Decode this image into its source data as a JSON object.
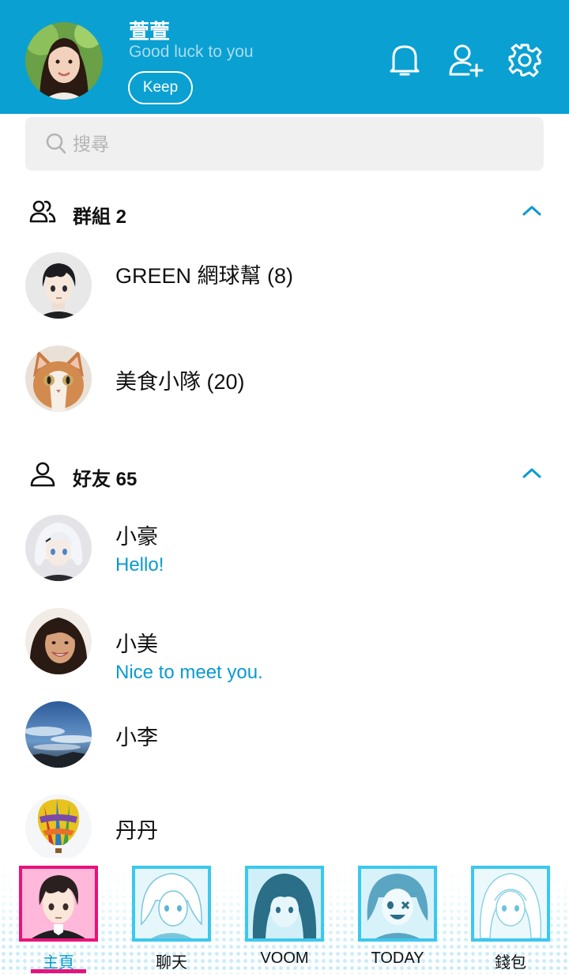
{
  "header": {
    "name": "萱萱",
    "status": "Good luck to you",
    "keep_label": "Keep",
    "icons": [
      "bell-icon",
      "add-friend-icon",
      "gear-icon"
    ]
  },
  "search": {
    "placeholder": "搜尋"
  },
  "groups": {
    "title": "群組 2",
    "items": [
      {
        "name": "GREEN 網球幫 (8)",
        "avatar": "anime-boy"
      },
      {
        "name": "美食小隊 (20)",
        "avatar": "cat"
      }
    ]
  },
  "friends": {
    "title": "好友 65",
    "items": [
      {
        "name": "小豪",
        "message": "Hello!",
        "avatar": "anime-white-hair"
      },
      {
        "name": "小美",
        "message": "Nice to meet you.",
        "avatar": "woman-smiling"
      },
      {
        "name": "小李",
        "avatar": "sky"
      },
      {
        "name": "丹丹",
        "avatar": "hot-air-balloon"
      }
    ]
  },
  "nav": {
    "items": [
      {
        "label": "主頁",
        "active": true
      },
      {
        "label": "聊天"
      },
      {
        "label": "VOOM"
      },
      {
        "label": "TODAY"
      },
      {
        "label": "錢包"
      }
    ]
  },
  "colors": {
    "header": "#0aa0d2",
    "accent": "#0a9ad0",
    "active_nav": "#e8127a",
    "nav_border": "#3cc8ee"
  }
}
